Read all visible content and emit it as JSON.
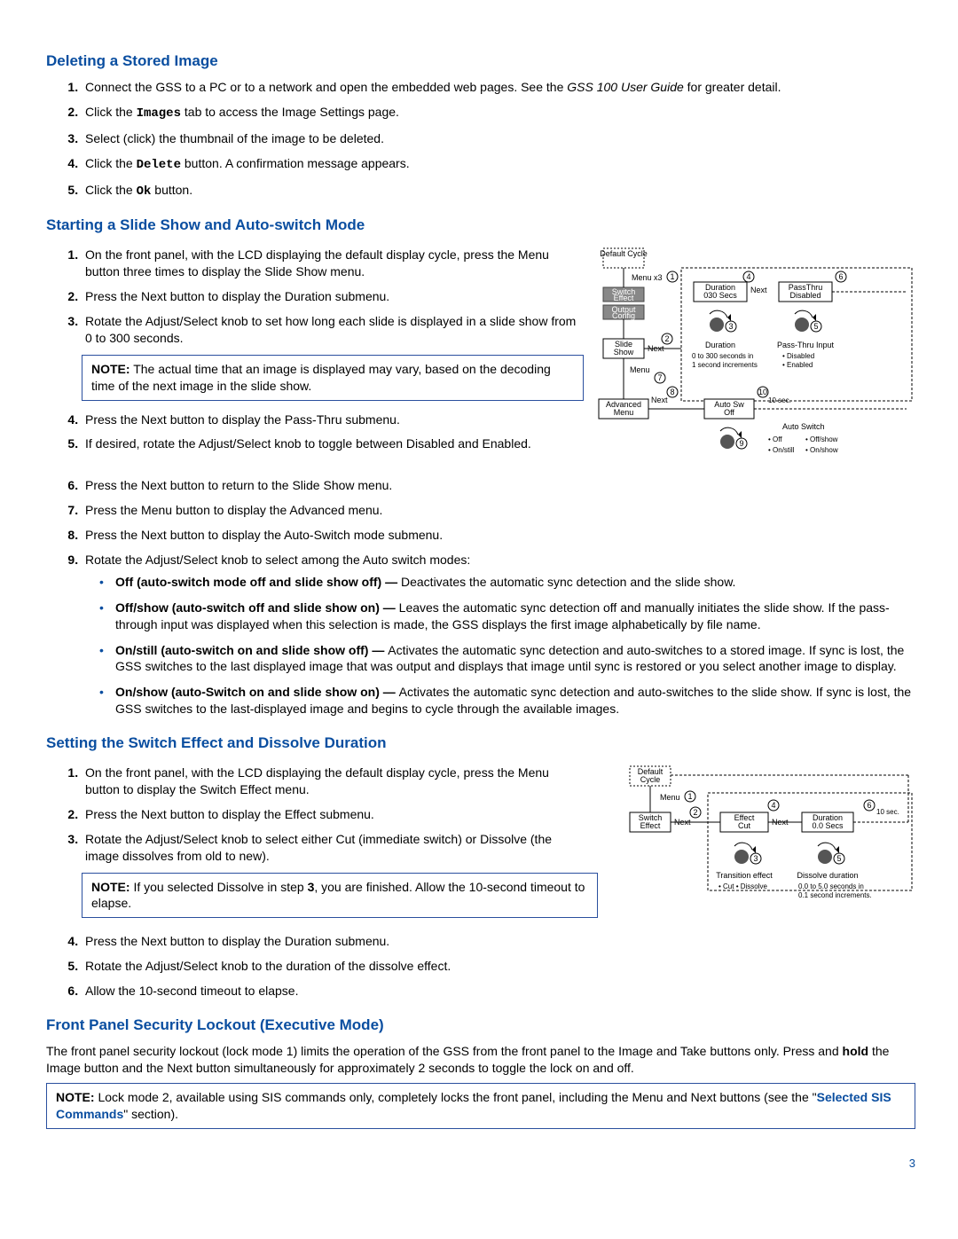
{
  "sections": {
    "deleting": {
      "title": "Deleting a Stored Image",
      "steps": [
        {
          "pre": "Connect the GSS to a PC or to a network and open the embedded web pages. See the ",
          "em": "GSS 100 User Guide",
          "post": " for greater detail."
        },
        {
          "pre": "Click the ",
          "code": "Images",
          "post": " tab to access the Image Settings page."
        },
        {
          "text": "Select (click) the thumbnail of the image to be deleted."
        },
        {
          "pre": "Click the ",
          "code": "Delete",
          "post": " button. A confirmation message appears."
        },
        {
          "pre": "Click the ",
          "code": "Ok",
          "post": " button."
        }
      ]
    },
    "slideshow": {
      "title": "Starting a Slide Show and Auto-switch Mode",
      "steps_a": [
        "On the front panel, with the LCD displaying the default display cycle, press the Menu button three times to display the Slide Show menu.",
        "Press the Next button to display the Duration submenu.",
        "Rotate the Adjust/Select knob to set how long each slide is displayed in a slide show from 0 to 300 seconds."
      ],
      "note1": "The actual time that an image is displayed may vary, based on the decoding time of the next image in the slide show.",
      "steps_b": [
        "Press the Next button to display the Pass-Thru submenu.",
        "If desired, rotate the Adjust/Select knob to toggle between Disabled and Enabled.",
        "Press the Next button to return to the Slide Show menu.",
        "Press the Menu button to display the Advanced menu.",
        "Press the Next button to display the Auto-Switch mode submenu.",
        "Rotate the Adjust/Select knob to select among the Auto switch modes:"
      ],
      "modes": [
        {
          "b": "Off (auto-switch mode off and slide show off) — ",
          "t": "Deactivates the automatic sync detection and the slide show."
        },
        {
          "b": "Off/show (auto-switch off and slide show on) — ",
          "t": "Leaves the automatic sync detection off and manually initiates the slide show. If the pass-through input was displayed when this selection is made, the GSS displays the first image alphabetically by file name."
        },
        {
          "b": "On/still (auto-switch on and slide show off) — ",
          "t": "Activates the automatic sync detection and auto-switches to a stored image. If sync is lost, the GSS switches to the last displayed image that was output and displays that image until sync is restored or you select another image to display."
        },
        {
          "b": "On/show (auto-Switch on and slide show on) — ",
          "t": "Activates the automatic sync detection and auto-switches to the slide show. If sync is lost, the GSS switches to the last-displayed image and begins to cycle through the available images."
        }
      ],
      "diagram": {
        "default_cycle": "Default Cycle",
        "menu_x3": "Menu x3",
        "switch_effect": "Switch Effect",
        "output_config": "Output Config",
        "slide_show": "Slide Show",
        "menu": "Menu",
        "advanced_menu": "Advanced Menu",
        "next": "Next",
        "duration_box": "Duration 030  Secs",
        "passthru_box": "PassThru Disabled",
        "autosw_box": "Auto Sw Off",
        "duration_label": "Duration",
        "duration_desc1": "0 to 300 seconds in",
        "duration_desc2": "1 second increments",
        "passthru_label": "Pass-Thru Input",
        "passthru_opt1": "Disabled",
        "passthru_opt2": "Enabled",
        "autosw_label": "Auto Switch",
        "autosw_opts": [
          "Off",
          "Off/show",
          "On/still",
          "On/show"
        ],
        "refs": [
          "1",
          "2",
          "3",
          "4",
          "5",
          "6",
          "7",
          "8",
          "9",
          "10"
        ],
        "ten_sec": "10 sec."
      }
    },
    "switcheffect": {
      "title": "Setting the Switch Effect and Dissolve Duration",
      "steps_a": [
        "On the front panel, with the LCD displaying the default display cycle, press the Menu button to display the Switch Effect menu.",
        "Press the Next button to display the Effect submenu.",
        "Rotate the Adjust/Select knob to select either Cut (immediate switch) or Dissolve (the image dissolves from old to new)."
      ],
      "note": "If you selected Dissolve in step ",
      "note_step": "3",
      "note_post": ", you are finished. Allow the 10-second timeout to elapse.",
      "steps_b": [
        "Press the Next button to display the Duration submenu.",
        "Rotate the Adjust/Select knob to the duration of the dissolve effect.",
        "Allow the 10-second timeout to elapse."
      ],
      "diagram": {
        "default_cycle": "Default Cycle",
        "menu": "Menu",
        "switch_effect": "Switch Effect",
        "next": "Next",
        "effect_box": "Effect Cut",
        "duration_box": "Duration 0.0 Secs",
        "transition_label": "Transition effect",
        "opts": [
          "Cut",
          "Dissolve"
        ],
        "dissolve_label": "Dissolve duration",
        "dissolve_desc1": "0.0 to 5.0 seconds in",
        "dissolve_desc2": "0.1 second increments.",
        "ten_sec": "10 sec.",
        "refs": [
          "1",
          "2",
          "3",
          "4",
          "5",
          "6"
        ]
      }
    },
    "lockout": {
      "title": "Front Panel Security Lockout (Executive Mode)",
      "para_pre": "The front panel security lockout (lock mode 1) limits the operation of the GSS from the front panel to the Image and Take buttons only. Press and ",
      "hold": "hold",
      "para_post": " the Image button and the Next button simultaneously for approximately 2 seconds to toggle the lock on and off.",
      "note_pre": "Lock mode 2, available using SIS commands only, completely locks the front panel, including the Menu and Next buttons (see the \"",
      "note_link": "Selected SIS Commands",
      "note_post": "\" section)."
    }
  },
  "labels": {
    "note": "NOTE:"
  },
  "page_number": "3"
}
